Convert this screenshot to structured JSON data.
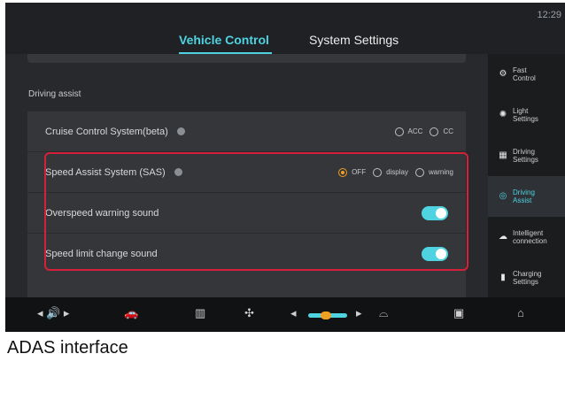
{
  "status": {
    "time": "12:29"
  },
  "tabs": [
    {
      "label": "Vehicle Control"
    },
    {
      "label": "System Settings"
    }
  ],
  "section": {
    "title": "Driving assist"
  },
  "rows": {
    "cruise": {
      "label": "Cruise Control System(beta)",
      "options": [
        "ACC",
        "CC"
      ]
    },
    "sas": {
      "label": "Speed Assist System (SAS)",
      "options": [
        "OFF",
        "display",
        "warning"
      ],
      "selected": "OFF"
    },
    "overspeed": {
      "label": "Overspeed warning sound",
      "enabled": true
    },
    "speedlimit": {
      "label": "Speed limit change sound",
      "enabled": true
    }
  },
  "sidebar": {
    "items": [
      {
        "label": "Fast\nControl",
        "icon": "fast-control-icon"
      },
      {
        "label": "Light\nSettings",
        "icon": "light-icon"
      },
      {
        "label": "Driving\nSettings",
        "icon": "driving-settings-icon"
      },
      {
        "label": "Driving\nAssist",
        "icon": "steering-wheel-icon",
        "active": true
      },
      {
        "label": "Intelligent\nconnection",
        "icon": "cloud-icon"
      },
      {
        "label": "Charging\nSettings",
        "icon": "charging-icon"
      }
    ]
  },
  "dock": {
    "icons": [
      "volume-icon",
      "car-outline-icon",
      "rear-defrost-icon",
      "fan-icon",
      "temperature-slider",
      "front-defrost-icon",
      "car-front-icon",
      "home-icon"
    ]
  },
  "caption": "ADAS interface",
  "colors": {
    "accent": "#4fd3e0",
    "selected": "#f0a020",
    "highlight": "#d6203a"
  }
}
